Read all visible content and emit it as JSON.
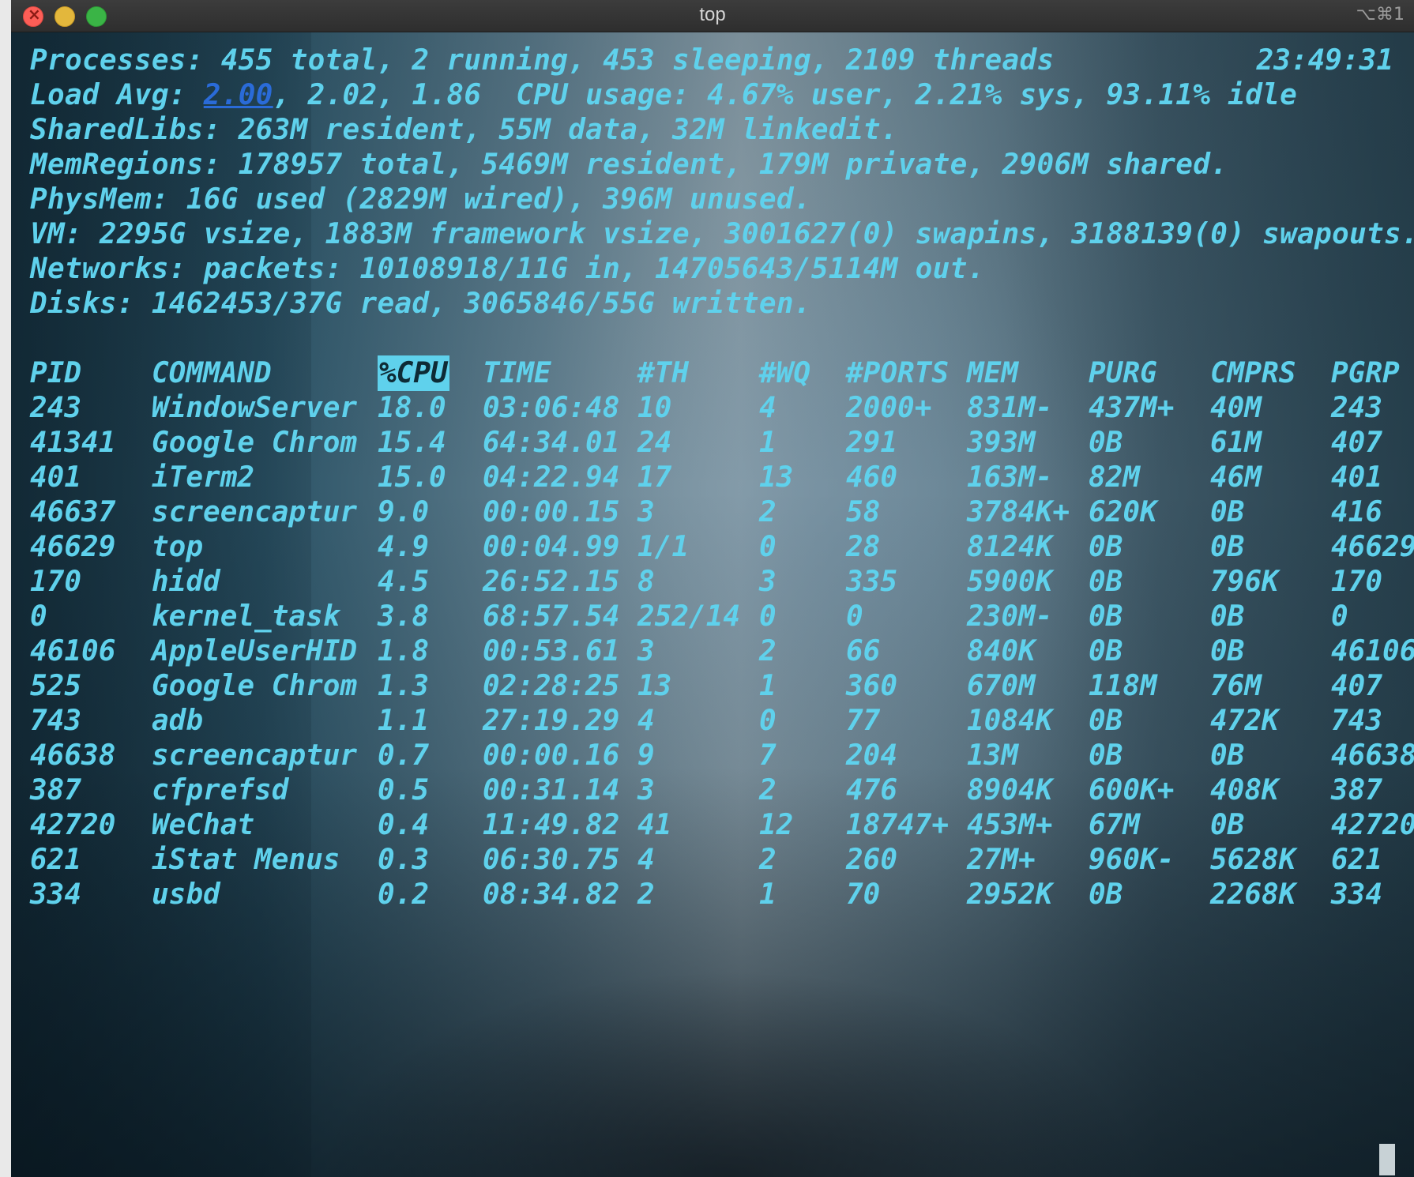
{
  "window": {
    "title": "top",
    "shortcut": "⌥⌘1"
  },
  "summary": {
    "processes": "Processes: 455 total, 2 running, 453 sleeping, 2109 threads",
    "clock": "23:49:31",
    "load_prefix": "Load Avg: ",
    "load_first": "2.00",
    "load_rest": ", 2.02, 1.86  CPU usage: 4.67% user, 2.21% sys, 93.11% idle",
    "sharedlibs": "SharedLibs: 263M resident, 55M data, 32M linkedit.",
    "memregions": "MemRegions: 178957 total, 5469M resident, 179M private, 2906M shared.",
    "physmem": "PhysMem: 16G used (2829M wired), 396M unused.",
    "vm": "VM: 2295G vsize, 1883M framework vsize, 3001627(0) swapins, 3188139(0) swapouts.",
    "networks": "Networks: packets: 10108918/11G in, 14705643/5114M out.",
    "disks": "Disks: 1462453/37G read, 3065846/55G written."
  },
  "table": {
    "headers": [
      "PID",
      "COMMAND",
      "%CPU",
      "TIME",
      "#TH",
      "#WQ",
      "#PORTS",
      "MEM",
      "PURG",
      "CMPRS",
      "PGRP"
    ],
    "rows": [
      [
        "243",
        "WindowServer",
        "18.0",
        "03:06:48",
        "10",
        "4",
        "2000+",
        "831M-",
        "437M+",
        "40M",
        "243"
      ],
      [
        "41341",
        "Google Chrom",
        "15.4",
        "64:34.01",
        "24",
        "1",
        "291",
        "393M",
        "0B",
        "61M",
        "407"
      ],
      [
        "401",
        "iTerm2",
        "15.0",
        "04:22.94",
        "17",
        "13",
        "460",
        "163M-",
        "82M",
        "46M",
        "401"
      ],
      [
        "46637",
        "screencaptur",
        "9.0",
        "00:00.15",
        "3",
        "2",
        "58",
        "3784K+",
        "620K",
        "0B",
        "416"
      ],
      [
        "46629",
        "top",
        "4.9",
        "00:04.99",
        "1/1",
        "0",
        "28",
        "8124K",
        "0B",
        "0B",
        "46629"
      ],
      [
        "170",
        "hidd",
        "4.5",
        "26:52.15",
        "8",
        "3",
        "335",
        "5900K",
        "0B",
        "796K",
        "170"
      ],
      [
        "0",
        "kernel_task",
        "3.8",
        "68:57.54",
        "252/14",
        "0",
        "0",
        "230M-",
        "0B",
        "0B",
        "0"
      ],
      [
        "46106",
        "AppleUserHID",
        "1.8",
        "00:53.61",
        "3",
        "2",
        "66",
        "840K",
        "0B",
        "0B",
        "46106"
      ],
      [
        "525",
        "Google Chrom",
        "1.3",
        "02:28:25",
        "13",
        "1",
        "360",
        "670M",
        "118M",
        "76M",
        "407"
      ],
      [
        "743",
        "adb",
        "1.1",
        "27:19.29",
        "4",
        "0",
        "77",
        "1084K",
        "0B",
        "472K",
        "743"
      ],
      [
        "46638",
        "screencaptur",
        "0.7",
        "00:00.16",
        "9",
        "7",
        "204",
        "13M",
        "0B",
        "0B",
        "46638"
      ],
      [
        "387",
        "cfprefsd",
        "0.5",
        "00:31.14",
        "3",
        "2",
        "476",
        "8904K",
        "600K+",
        "408K",
        "387"
      ],
      [
        "42720",
        "WeChat",
        "0.4",
        "11:49.82",
        "41",
        "12",
        "18747+",
        "453M+",
        "67M",
        "0B",
        "42720"
      ],
      [
        "621",
        "iStat Menus",
        "0.3",
        "06:30.75",
        "4",
        "2",
        "260",
        "27M+",
        "960K-",
        "5628K",
        "621"
      ],
      [
        "334",
        "usbd",
        "0.2",
        "08:34.82",
        "2",
        "1",
        "70",
        "2952K",
        "0B",
        "2268K",
        "334"
      ]
    ]
  },
  "colors": {
    "text": "#5fd1ec",
    "highlight": "#2a6bd8"
  }
}
